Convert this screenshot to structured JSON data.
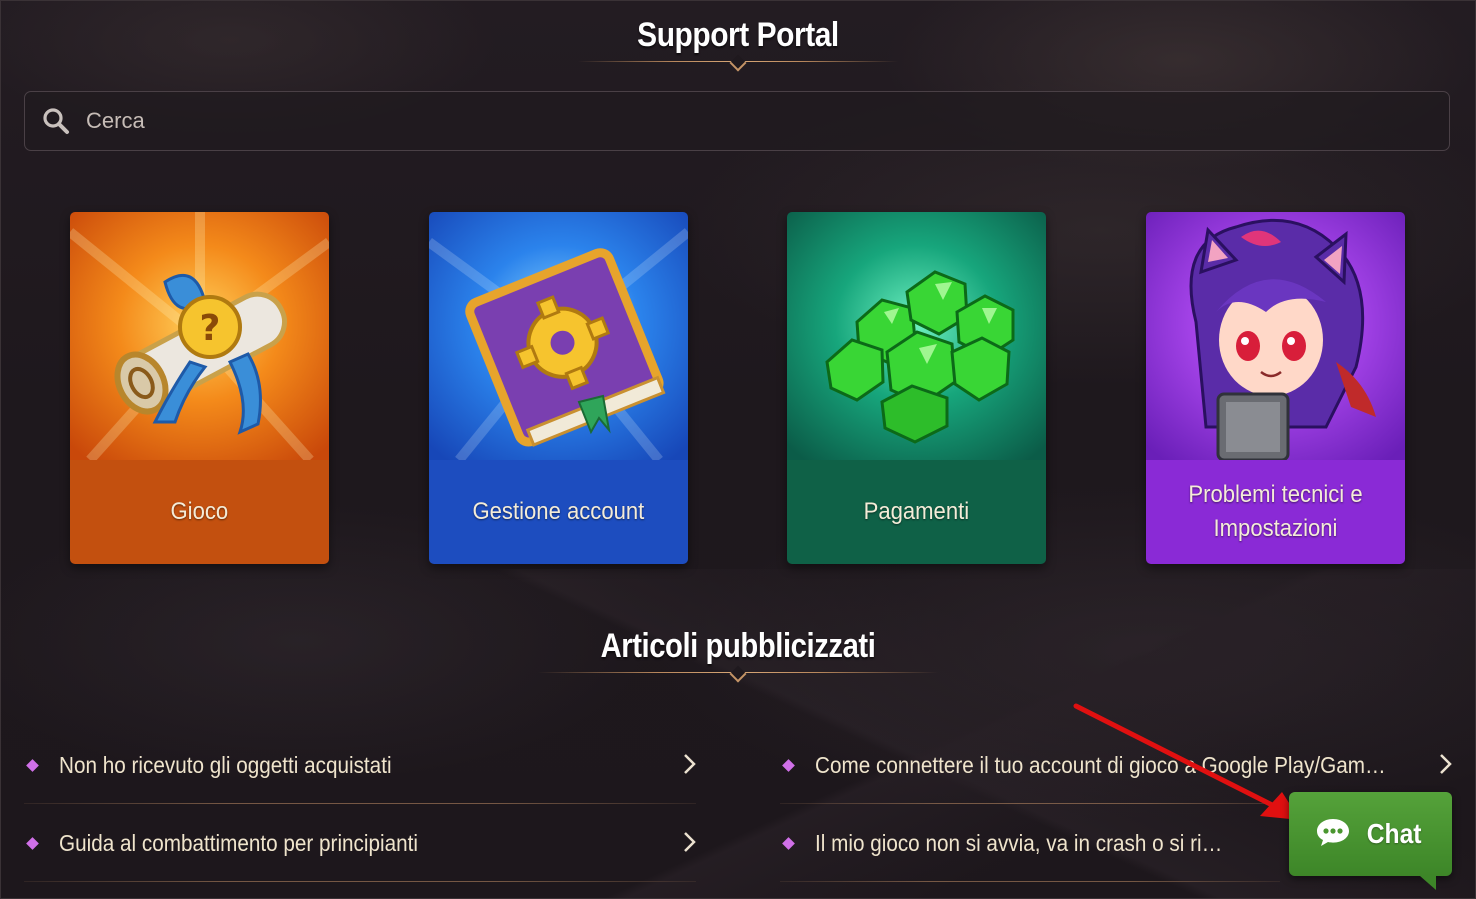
{
  "page": {
    "title": "Support Portal",
    "featured_heading": "Articoli pubblicizzati"
  },
  "search": {
    "placeholder": "Cerca",
    "icon": "search-icon"
  },
  "categories": [
    {
      "label": "Gioco",
      "icon": "help-scroll-icon",
      "color": "#e2620f"
    },
    {
      "label": "Gestione account",
      "icon": "gear-book-icon",
      "color": "#1e63d6"
    },
    {
      "label": "Pagamenti",
      "icon": "gems-icon",
      "color": "#128a63"
    },
    {
      "label": "Problemi tecnici e Impostazioni",
      "icon": "character-icon",
      "color": "#8a2ad6"
    }
  ],
  "articles": [
    {
      "title": "Non ho ricevuto gli oggetti acquistati"
    },
    {
      "title": "Come connettere il tuo account di gioco a Google Play/Game..."
    },
    {
      "title": "Guida al combattimento per principianti"
    },
    {
      "title": "Il mio gioco non si avvia, va in crash o si riavvia"
    }
  ],
  "chat": {
    "label": "Chat",
    "icon": "chat-bubble-icon",
    "color": "#4a962f"
  },
  "annotation": {
    "color": "#e01010"
  }
}
